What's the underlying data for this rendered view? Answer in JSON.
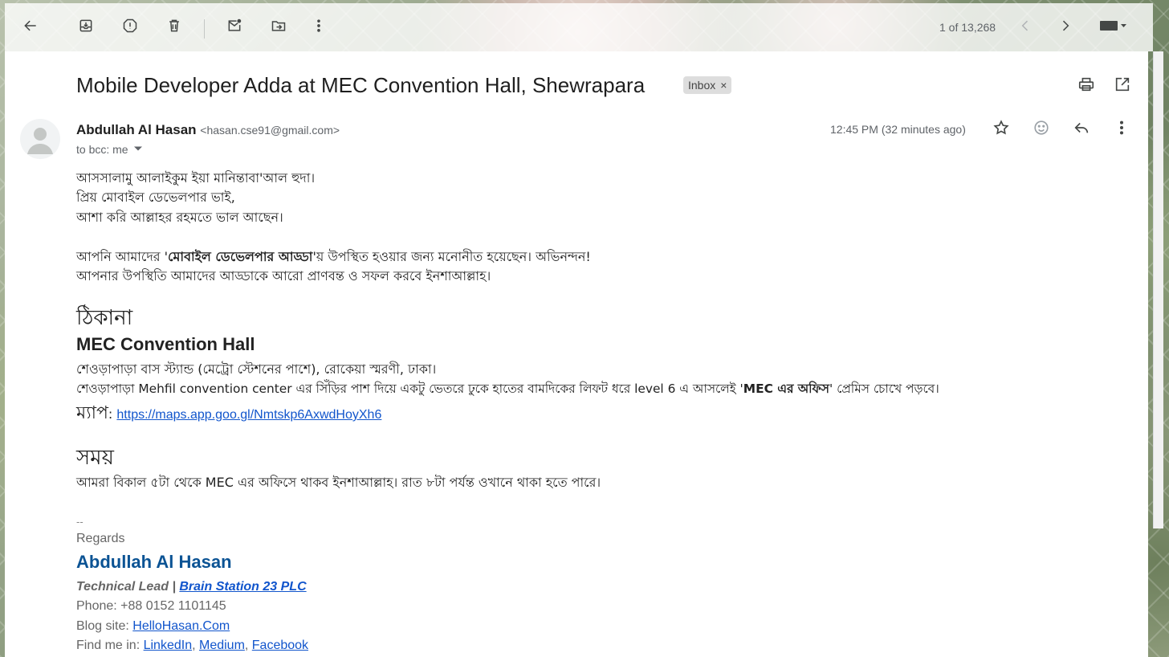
{
  "toolbar": {
    "pager_text": "1 of 13,268"
  },
  "email": {
    "subject": "Mobile Developer Adda at MEC Convention Hall, Shewrapara",
    "label": "Inbox",
    "label_close": "×",
    "sender_name": "Abdullah Al Hasan",
    "sender_email": "<hasan.cse91@gmail.com>",
    "recipients": "to bcc: me",
    "time": "12:45 PM (32 minutes ago)"
  },
  "body": {
    "greeting1": "আসসালামু আলাইকুম ইয়া মানিন্তাবা'আল হুদা।",
    "greeting2": "প্রিয় মোবাইল ডেভেলপার ভাই,",
    "greeting3": "আশা করি আল্লাহর রহমতে ভাল আছেন।",
    "invite_pre": "আপনি আমাদের '",
    "invite_bold": "মোবাইল ডেভেলপার আড্ডা",
    "invite_post": "'য় উপস্থিত হওয়ার জন্য মনোনীত হয়েছেন। অভিনন্দন!",
    "invite2": "আপনার উপস্থিতি আমাদের আড্ডাকে আরো প্রাণবন্ত ও সফল করবে ইনশাআল্লাহ।",
    "address_heading": "ঠিকানা",
    "venue": "MEC Convention Hall",
    "address1": "শেওড়াপাড়া বাস স্ট্যান্ড (মেট্রো স্টেশনের পাশে), রোকেয়া স্মরণী, ঢাকা।",
    "address2_pre": "শেওড়াপাড়া Mehfil convention center এর সিঁড়ির পাশ দিয়ে একটু ভেতরে ঢুকে হাতের বামদিকের লিফট ধরে level 6 এ আসলেই '",
    "address2_bold": "MEC এর অফিস",
    "address2_post": "' প্রেমিস চোখে পড়বে।",
    "map_label": "ম্যাপ",
    "map_colon": ": ",
    "map_link": "https://maps.app.goo.gl/Nmtskp6AxwdHoyXh6",
    "time_heading": "সময়",
    "time_text": "আমরা বিকাল ৫টা থেকে MEC এর অফিসে থাকব ইনশাআল্লাহ। রাত ৮টা পর্যন্ত ওখানে থাকা হতে পারে।"
  },
  "signature": {
    "dashes": "--",
    "regards": "Regards",
    "name": "Abdullah Al Hasan",
    "role": "Technical Lead | ",
    "company": "Brain Station 23 PLC",
    "phone": "Phone: +88 0152 1101145",
    "blog_label": "Blog site: ",
    "blog_link": "HelloHasan.Com",
    "find_label": "Find me in: ",
    "linkedin": "LinkedIn",
    "medium": "Medium",
    "facebook": "Facebook",
    "comma": ", "
  }
}
